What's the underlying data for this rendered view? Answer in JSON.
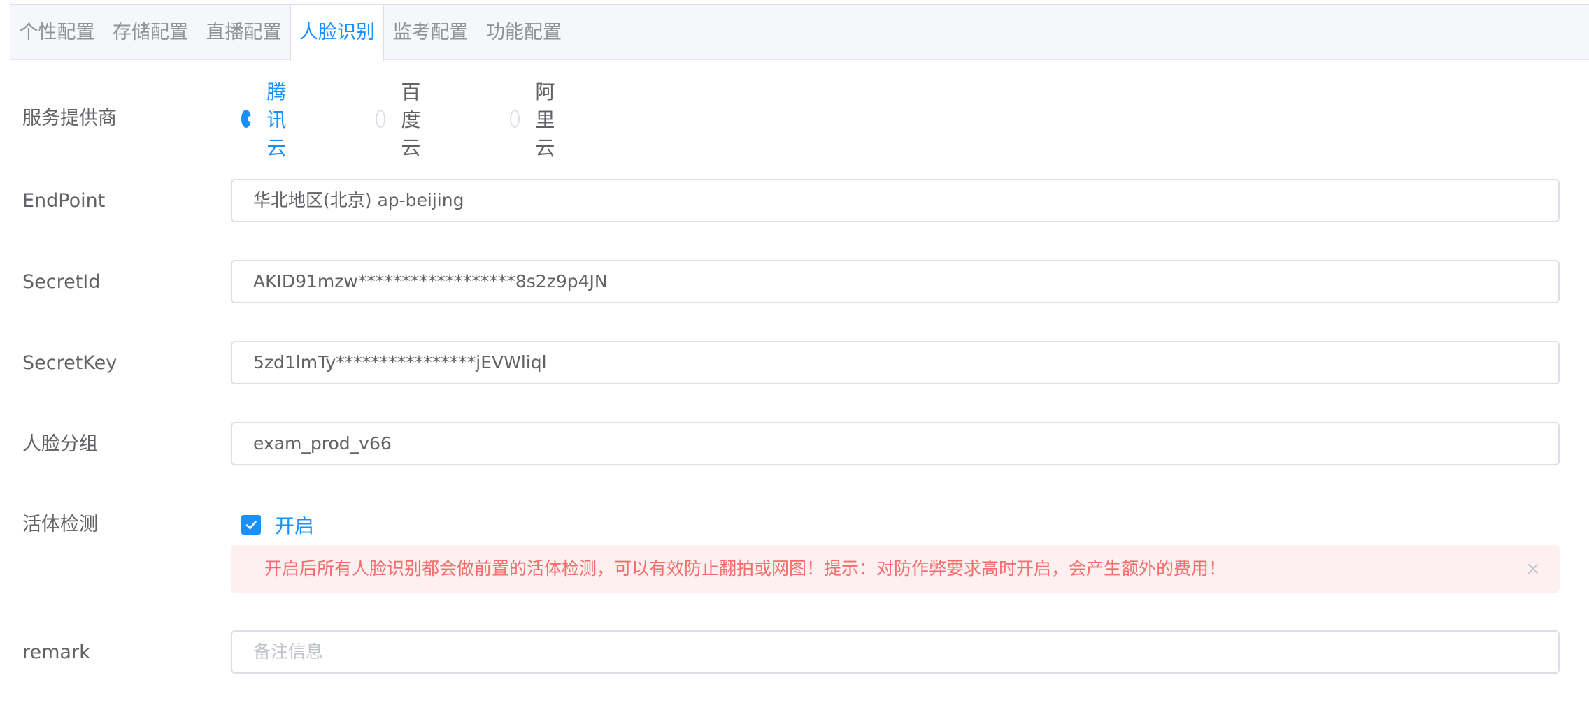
{
  "tabs": [
    "个性配置",
    "存储配置",
    "直播配置",
    "人脸识别",
    "监考配置",
    "功能配置"
  ],
  "active_tab": "人脸识别",
  "form": {
    "provider": {
      "label": "服务提供商",
      "options": [
        "腾讯云",
        "百度云",
        "阿里云"
      ],
      "selected": "腾讯云"
    },
    "endpoint": {
      "label": "EndPoint",
      "value": "华北地区(北京) ap-beijing"
    },
    "secret_id": {
      "label": "SecretId",
      "value": "AKID91mzw******************8s2z9p4JN"
    },
    "secret_key": {
      "label": "SecretKey",
      "value": "5zd1lmTy****************jEVWliql"
    },
    "face_group": {
      "label": "人脸分组",
      "value": "exam_prod_v66"
    },
    "liveness": {
      "label": "活体检测",
      "checkbox_label": "开启",
      "checked": true,
      "alert_text": "开启后所有人脸识别都会做前置的活体检测，可以有效防止翻拍或网图！提示：对防作弊要求高时开启，会产生额外的费用！"
    },
    "remark": {
      "label": "remark",
      "value": "",
      "placeholder": "备注信息"
    }
  },
  "colors": {
    "primary": "#1890ff",
    "alert_bg": "#fef0f0",
    "alert_text": "#f56c6c",
    "border": "#dcdfe6"
  },
  "icons": [
    "check-icon",
    "close-icon"
  ]
}
